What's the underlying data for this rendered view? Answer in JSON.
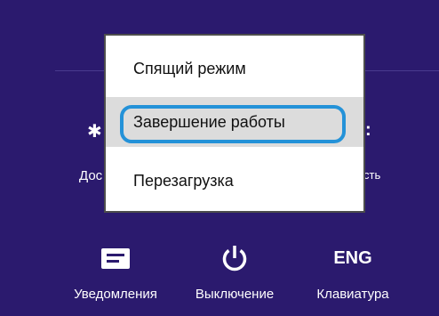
{
  "power_menu": {
    "items": [
      {
        "label": "Спящий режим"
      },
      {
        "label": "Завершение работы",
        "highlighted": true
      },
      {
        "label": "Перезагрузка"
      }
    ]
  },
  "background_labels": {
    "left_partial": "Дос",
    "right_partial": "сть"
  },
  "tray": {
    "notifications_label": "Уведомления",
    "notifications_icon": "notifications-icon",
    "power_label": "Выключение",
    "power_icon": "power-icon",
    "keyboard_label": "Клавиатура",
    "keyboard_text": "ENG"
  },
  "colors": {
    "background": "#2b1a6e",
    "menu_background": "#ffffff",
    "selected_item": "#dcdcdc",
    "highlight_ring": "#2492d8"
  }
}
